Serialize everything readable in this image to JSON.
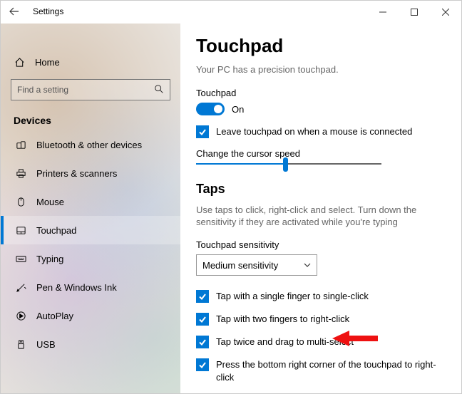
{
  "window": {
    "title": "Settings"
  },
  "sidebar": {
    "home_label": "Home",
    "search_placeholder": "Find a setting",
    "section_header": "Devices",
    "items": [
      {
        "label": "Bluetooth & other devices",
        "icon": "bluetooth-devices"
      },
      {
        "label": "Printers & scanners",
        "icon": "printer"
      },
      {
        "label": "Mouse",
        "icon": "mouse"
      },
      {
        "label": "Touchpad",
        "icon": "touchpad",
        "selected": true
      },
      {
        "label": "Typing",
        "icon": "typing"
      },
      {
        "label": "Pen & Windows Ink",
        "icon": "pen"
      },
      {
        "label": "AutoPlay",
        "icon": "autoplay"
      },
      {
        "label": "USB",
        "icon": "usb"
      }
    ]
  },
  "main": {
    "heading": "Touchpad",
    "subtext": "Your PC has a precision touchpad.",
    "touchpad_label": "Touchpad",
    "toggle_state": "On",
    "leave_on_checkbox": "Leave touchpad on when a mouse is connected",
    "cursor_speed_label": "Change the cursor speed",
    "cursor_speed_percent": 48,
    "taps_heading": "Taps",
    "taps_desc": "Use taps to click, right-click and select. Turn down the sensitivity if they are activated while you're typing",
    "sensitivity_label": "Touchpad sensitivity",
    "sensitivity_value": "Medium sensitivity",
    "tap_checks": [
      "Tap with a single finger to single-click",
      "Tap with two fingers to right-click",
      "Tap twice and drag to multi-select",
      "Press the bottom right corner of the touchpad to right-click"
    ]
  }
}
